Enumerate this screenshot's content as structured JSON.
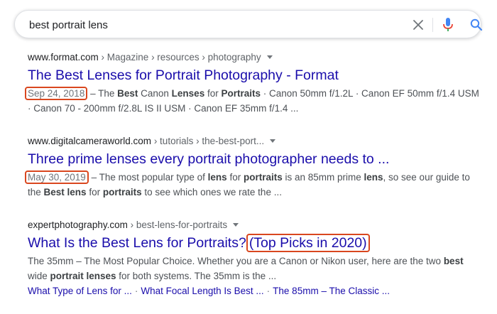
{
  "search": {
    "query": "best portrait lens"
  },
  "icons": {
    "clear": "close-icon",
    "mic": "microphone-icon",
    "search": "search-icon"
  },
  "colors": {
    "link": "#1a0dab",
    "highlight_box": "#d9471f",
    "mic_blue": "#4285f4",
    "mic_red": "#ea4335"
  },
  "results": [
    {
      "domain": "www.format.com",
      "path": " › Magazine › resources › photography",
      "title": "The Best Lenses for Portrait Photography - Format",
      "date": "Sep 24, 2018",
      "snippet": [
        {
          "t": " – The ",
          "b": false
        },
        {
          "t": "Best",
          "b": true
        },
        {
          "t": " Canon ",
          "b": false
        },
        {
          "t": "Lenses",
          "b": true
        },
        {
          "t": " for ",
          "b": false
        },
        {
          "t": "Portraits",
          "b": true
        },
        {
          "t": " · Canon 50mm f/1.2L · Canon EF 50mm f/1.4 USM · Canon 70 - 200mm f/2.8L IS II USM · Canon EF 35mm f/1.4 ...",
          "b": false
        }
      ]
    },
    {
      "domain": "www.digitalcameraworld.com",
      "path": " › tutorials › the-best-port...",
      "title": "Three prime lenses every portrait photographer needs to ...",
      "date": "May 30, 2019",
      "snippet": [
        {
          "t": " – The most popular type of ",
          "b": false
        },
        {
          "t": "lens",
          "b": true
        },
        {
          "t": " for ",
          "b": false
        },
        {
          "t": "portraits",
          "b": true
        },
        {
          "t": " is an 85mm prime ",
          "b": false
        },
        {
          "t": "lens",
          "b": true
        },
        {
          "t": ", so see our guide to the ",
          "b": false
        },
        {
          "t": "Best lens",
          "b": true
        },
        {
          "t": " for ",
          "b": false
        },
        {
          "t": "portraits",
          "b": true
        },
        {
          "t": " to see which ones we rate the ...",
          "b": false
        }
      ]
    },
    {
      "domain": "expertphotography.com",
      "path": " › best-lens-for-portraits",
      "title": "What Is the Best Lens for Portraits?",
      "title_highlight": "(Top Picks in 2020)",
      "snippet": [
        {
          "t": "The 35mm – The Most Popular Choice. Whether you are a Canon or Nikon user, here are the two ",
          "b": false
        },
        {
          "t": "best",
          "b": true
        },
        {
          "t": " wide ",
          "b": false
        },
        {
          "t": "portrait lenses",
          "b": true
        },
        {
          "t": " for both systems. The 35mm is the ...",
          "b": false
        }
      ],
      "sitelinks": [
        "What Type of Lens for ...",
        "What Focal Length Is Best ...",
        "The 85mm – The Classic ..."
      ]
    }
  ]
}
